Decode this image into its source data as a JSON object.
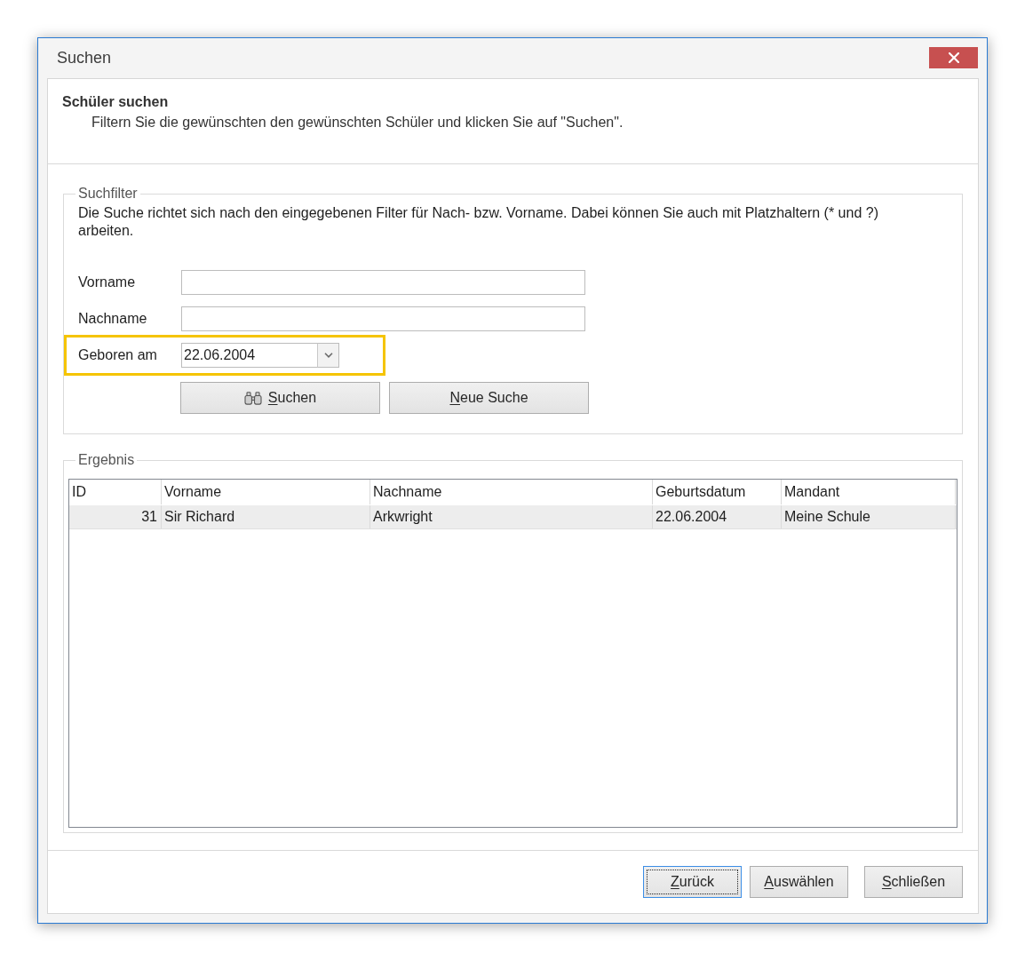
{
  "window": {
    "title": "Suchen"
  },
  "header": {
    "title": "Schüler suchen",
    "subtitle": "Filtern Sie die gewünschten den gewünschten Schüler und klicken Sie auf \"Suchen\"."
  },
  "search_filter": {
    "title": "Suchfilter",
    "description": "Die Suche richtet sich nach den eingegebenen Filter für Nach- bzw. Vorname. Dabei können Sie auch mit Platzhaltern (* und ?) arbeiten.",
    "fields": [
      {
        "label": "Vorname",
        "kind": "text",
        "highlighted": false
      },
      {
        "label": "Nachname",
        "kind": "text",
        "highlighted": false
      },
      {
        "label": "Geboren am",
        "kind": "date",
        "value": "22.06.2004",
        "highlighted": true
      }
    ],
    "buttons": [
      {
        "label": "Suchen",
        "has_icon": true,
        "mnemonic": true
      },
      {
        "label": "Neue Suche",
        "has_icon": false,
        "mnemonic": true
      }
    ]
  },
  "result": {
    "title": "Ergebnis",
    "table": {
      "columns": [
        {
          "label": "ID",
          "kind": "number"
        },
        {
          "label": "Vorname",
          "kind": "text"
        },
        {
          "label": "Nachname",
          "kind": "text"
        },
        {
          "label": "Geburtsdatum",
          "kind": "text"
        },
        {
          "label": "Mandant",
          "kind": "text"
        }
      ],
      "rows": [
        {
          "cells": [
            "31",
            "Sir Richard",
            "Arkwright",
            "22.06.2004",
            "Meine Schule"
          ],
          "selected": true
        }
      ]
    }
  },
  "footer_buttons": [
    {
      "label": "Zurück",
      "focused": true,
      "mnemonic": true
    },
    {
      "label": "Auswählen",
      "focused": false,
      "mnemonic": true
    },
    {
      "label": "Schließen",
      "focused": false,
      "mnemonic": true
    }
  ]
}
